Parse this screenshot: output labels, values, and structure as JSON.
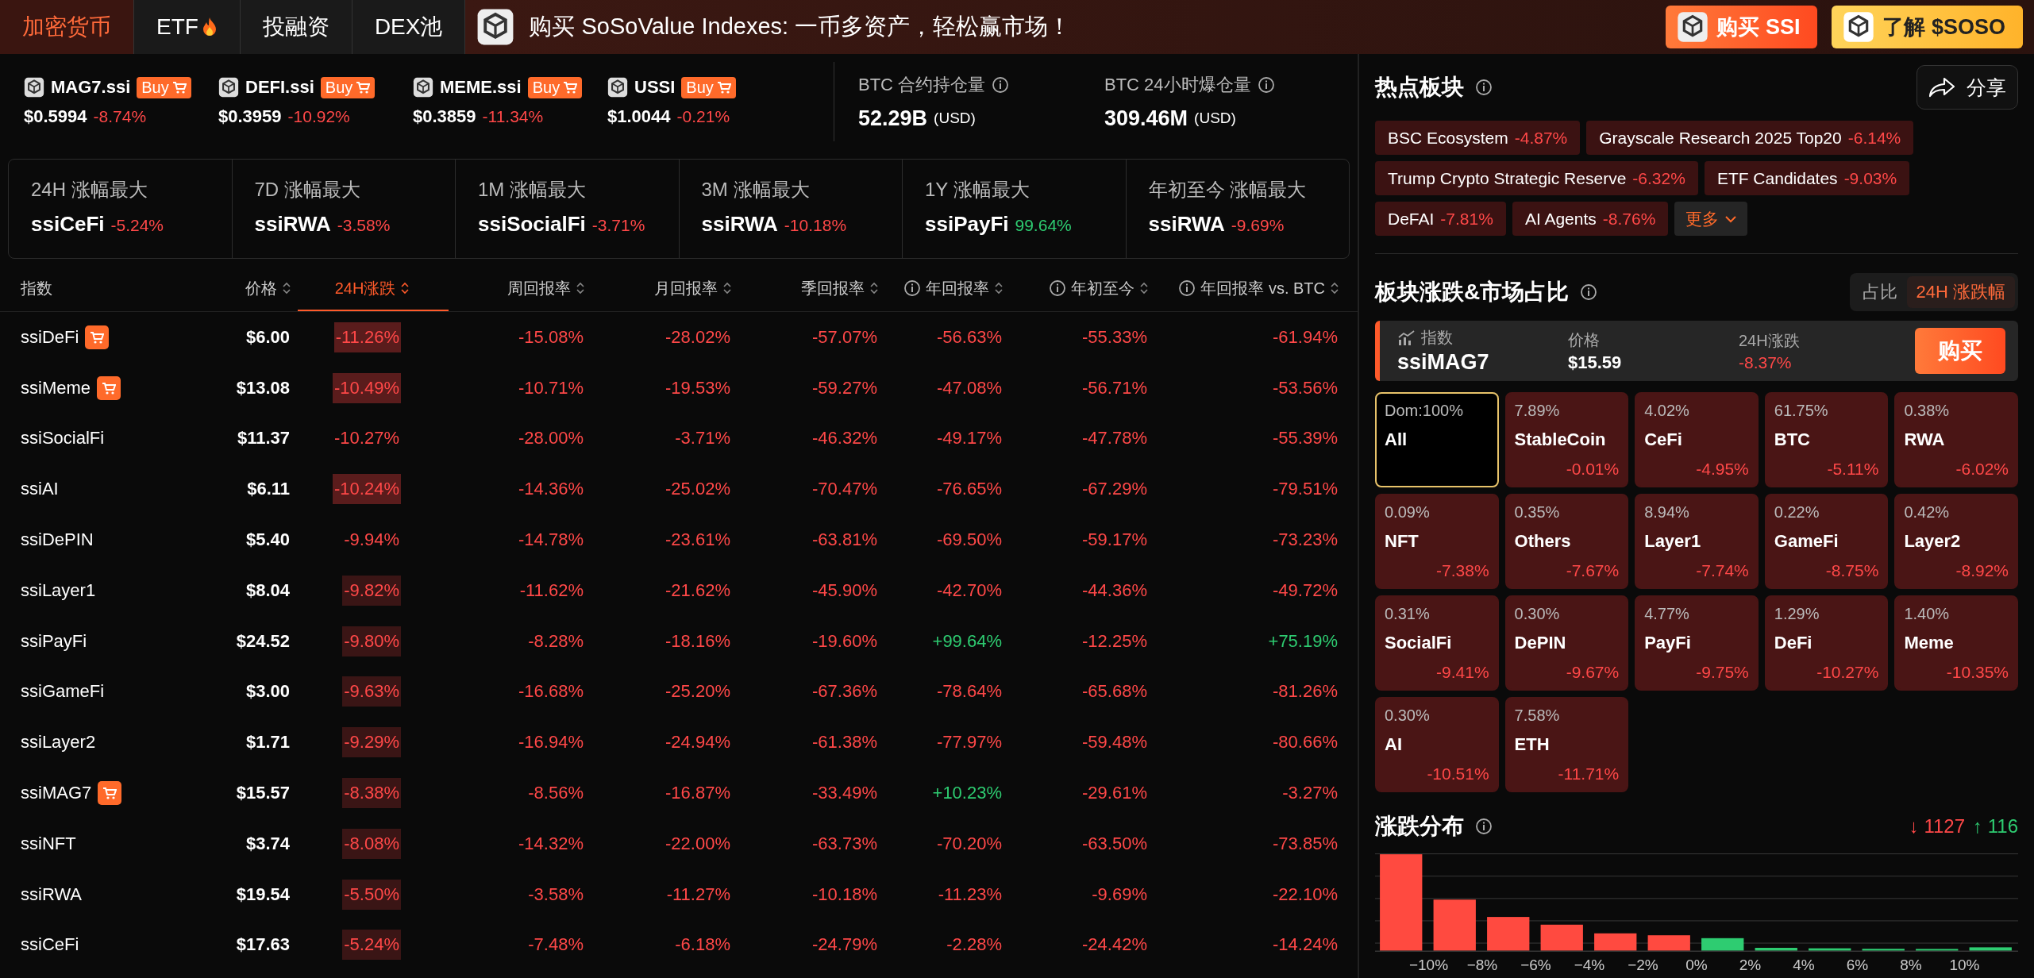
{
  "nav": {
    "tabs": [
      {
        "label": "加密货币",
        "selected": true,
        "hot": false
      },
      {
        "label": "ETF",
        "selected": false,
        "hot": true
      },
      {
        "label": "投融资",
        "selected": false,
        "hot": false
      },
      {
        "label": "DEX池",
        "selected": false,
        "hot": false
      }
    ]
  },
  "banner": {
    "text": "购买 SoSoValue Indexes: 一币多资产，轻松赢市场！",
    "buttons": [
      {
        "label": "购买 SSI",
        "kind": "primary"
      },
      {
        "label": "了解 $SOSO",
        "kind": "secondary"
      }
    ]
  },
  "tickers": [
    {
      "name": "MAG7.ssi",
      "buy": "Buy",
      "price": "$0.5994",
      "change": "-8.74%",
      "up": false
    },
    {
      "name": "DEFI.ssi",
      "buy": "Buy",
      "price": "$0.3959",
      "change": "-10.92%",
      "up": false
    },
    {
      "name": "MEME.ssi",
      "buy": "Buy",
      "price": "$0.3859",
      "change": "-11.34%",
      "up": false
    },
    {
      "name": "USSI",
      "buy": "Buy",
      "price": "$1.0044",
      "change": "-0.21%",
      "up": false
    }
  ],
  "metrics": [
    {
      "label": "BTC 合约持仓量",
      "value": "52.29B",
      "unit": "(USD)"
    },
    {
      "label": "BTC 24小时爆仓量",
      "value": "309.46M",
      "unit": "(USD)"
    }
  ],
  "leaders": [
    {
      "label": "24H 涨幅最大",
      "name": "ssiCeFi",
      "change": "-5.24%",
      "up": false
    },
    {
      "label": "7D 涨幅最大",
      "name": "ssiRWA",
      "change": "-3.58%",
      "up": false
    },
    {
      "label": "1M 涨幅最大",
      "name": "ssiSocialFi",
      "change": "-3.71%",
      "up": false
    },
    {
      "label": "3M 涨幅最大",
      "name": "ssiRWA",
      "change": "-10.18%",
      "up": false
    },
    {
      "label": "1Y 涨幅最大",
      "name": "ssiPayFi",
      "change": "99.64%",
      "up": true
    },
    {
      "label": "年初至今 涨幅最大",
      "name": "ssiRWA",
      "change": "-9.69%",
      "up": false
    }
  ],
  "table": {
    "columns": [
      {
        "label": "指数",
        "info": false,
        "sortable": false,
        "selected": false
      },
      {
        "label": "价格",
        "info": false,
        "sortable": true,
        "selected": false
      },
      {
        "label": "24H涨跌",
        "info": false,
        "sortable": true,
        "selected": true
      },
      {
        "label": "周回报率",
        "info": false,
        "sortable": true,
        "selected": false
      },
      {
        "label": "月回报率",
        "info": false,
        "sortable": true,
        "selected": false
      },
      {
        "label": "季回报率",
        "info": false,
        "sortable": true,
        "selected": false
      },
      {
        "label": "年回报率",
        "info": true,
        "sortable": true,
        "selected": false
      },
      {
        "label": "年初至今",
        "info": true,
        "sortable": true,
        "selected": false
      },
      {
        "label": "年回报率 vs. BTC",
        "info": true,
        "sortable": true,
        "selected": false
      }
    ],
    "rows": [
      {
        "cart": true,
        "highlighted": true,
        "strong": true,
        "cells": [
          {
            "text": "ssiDeFi"
          },
          {
            "text": "$6.00"
          },
          {
            "text": "-11.26%",
            "up": false
          },
          {
            "text": "-15.08%",
            "up": false
          },
          {
            "text": "-28.02%",
            "up": false
          },
          {
            "text": "-57.07%",
            "up": false
          },
          {
            "text": "-56.63%",
            "up": false
          },
          {
            "text": "-55.33%",
            "up": false
          },
          {
            "text": "-61.94%",
            "up": false
          }
        ]
      },
      {
        "cart": true,
        "highlighted": true,
        "strong": true,
        "cells": [
          {
            "text": "ssiMeme"
          },
          {
            "text": "$13.08"
          },
          {
            "text": "-10.49%",
            "up": false
          },
          {
            "text": "-10.71%",
            "up": false
          },
          {
            "text": "-19.53%",
            "up": false
          },
          {
            "text": "-59.27%",
            "up": false
          },
          {
            "text": "-47.08%",
            "up": false
          },
          {
            "text": "-56.71%",
            "up": false
          },
          {
            "text": "-53.56%",
            "up": false
          }
        ]
      },
      {
        "cart": false,
        "highlighted": false,
        "strong": false,
        "cells": [
          {
            "text": "ssiSocialFi"
          },
          {
            "text": "$11.37"
          },
          {
            "text": "-10.27%",
            "up": false
          },
          {
            "text": "-28.00%",
            "up": false
          },
          {
            "text": "-3.71%",
            "up": false
          },
          {
            "text": "-46.32%",
            "up": false
          },
          {
            "text": "-49.17%",
            "up": false
          },
          {
            "text": "-47.78%",
            "up": false
          },
          {
            "text": "-55.39%",
            "up": false
          }
        ]
      },
      {
        "cart": false,
        "highlighted": true,
        "strong": true,
        "cells": [
          {
            "text": "ssiAI"
          },
          {
            "text": "$6.11"
          },
          {
            "text": "-10.24%",
            "up": false
          },
          {
            "text": "-14.36%",
            "up": false
          },
          {
            "text": "-25.02%",
            "up": false
          },
          {
            "text": "-70.47%",
            "up": false
          },
          {
            "text": "-76.65%",
            "up": false
          },
          {
            "text": "-67.29%",
            "up": false
          },
          {
            "text": "-79.51%",
            "up": false
          }
        ]
      },
      {
        "cart": false,
        "highlighted": false,
        "strong": false,
        "cells": [
          {
            "text": "ssiDePIN"
          },
          {
            "text": "$5.40"
          },
          {
            "text": "-9.94%",
            "up": false
          },
          {
            "text": "-14.78%",
            "up": false
          },
          {
            "text": "-23.61%",
            "up": false
          },
          {
            "text": "-63.81%",
            "up": false
          },
          {
            "text": "-69.50%",
            "up": false
          },
          {
            "text": "-59.17%",
            "up": false
          },
          {
            "text": "-73.23%",
            "up": false
          }
        ]
      },
      {
        "cart": false,
        "highlighted": true,
        "strong": false,
        "cells": [
          {
            "text": "ssiLayer1"
          },
          {
            "text": "$8.04"
          },
          {
            "text": "-9.82%",
            "up": false
          },
          {
            "text": "-11.62%",
            "up": false
          },
          {
            "text": "-21.62%",
            "up": false
          },
          {
            "text": "-45.90%",
            "up": false
          },
          {
            "text": "-42.70%",
            "up": false
          },
          {
            "text": "-44.36%",
            "up": false
          },
          {
            "text": "-49.72%",
            "up": false
          }
        ]
      },
      {
        "cart": false,
        "highlighted": true,
        "strong": false,
        "cells": [
          {
            "text": "ssiPayFi"
          },
          {
            "text": "$24.52"
          },
          {
            "text": "-9.80%",
            "up": false
          },
          {
            "text": "-8.28%",
            "up": false
          },
          {
            "text": "-18.16%",
            "up": false
          },
          {
            "text": "-19.60%",
            "up": false
          },
          {
            "text": "+99.64%",
            "up": true
          },
          {
            "text": "-12.25%",
            "up": false
          },
          {
            "text": "+75.19%",
            "up": true
          }
        ]
      },
      {
        "cart": false,
        "highlighted": true,
        "strong": false,
        "cells": [
          {
            "text": "ssiGameFi"
          },
          {
            "text": "$3.00"
          },
          {
            "text": "-9.63%",
            "up": false
          },
          {
            "text": "-16.68%",
            "up": false
          },
          {
            "text": "-25.20%",
            "up": false
          },
          {
            "text": "-67.36%",
            "up": false
          },
          {
            "text": "-78.64%",
            "up": false
          },
          {
            "text": "-65.68%",
            "up": false
          },
          {
            "text": "-81.26%",
            "up": false
          }
        ]
      },
      {
        "cart": false,
        "highlighted": true,
        "strong": false,
        "cells": [
          {
            "text": "ssiLayer2"
          },
          {
            "text": "$1.71"
          },
          {
            "text": "-9.29%",
            "up": false
          },
          {
            "text": "-16.94%",
            "up": false
          },
          {
            "text": "-24.94%",
            "up": false
          },
          {
            "text": "-61.38%",
            "up": false
          },
          {
            "text": "-77.97%",
            "up": false
          },
          {
            "text": "-59.48%",
            "up": false
          },
          {
            "text": "-80.66%",
            "up": false
          }
        ]
      },
      {
        "cart": true,
        "highlighted": true,
        "strong": false,
        "cells": [
          {
            "text": "ssiMAG7"
          },
          {
            "text": "$15.57"
          },
          {
            "text": "-8.38%",
            "up": false
          },
          {
            "text": "-8.56%",
            "up": false
          },
          {
            "text": "-16.87%",
            "up": false
          },
          {
            "text": "-33.49%",
            "up": false
          },
          {
            "text": "+10.23%",
            "up": true
          },
          {
            "text": "-29.61%",
            "up": false
          },
          {
            "text": "-3.27%",
            "up": false
          }
        ]
      },
      {
        "cart": false,
        "highlighted": true,
        "strong": false,
        "cells": [
          {
            "text": "ssiNFT"
          },
          {
            "text": "$3.74"
          },
          {
            "text": "-8.08%",
            "up": false
          },
          {
            "text": "-14.32%",
            "up": false
          },
          {
            "text": "-22.00%",
            "up": false
          },
          {
            "text": "-63.73%",
            "up": false
          },
          {
            "text": "-70.20%",
            "up": false
          },
          {
            "text": "-63.50%",
            "up": false
          },
          {
            "text": "-73.85%",
            "up": false
          }
        ]
      },
      {
        "cart": false,
        "highlighted": true,
        "strong": false,
        "cells": [
          {
            "text": "ssiRWA"
          },
          {
            "text": "$19.54"
          },
          {
            "text": "-5.50%",
            "up": false
          },
          {
            "text": "-3.58%",
            "up": false
          },
          {
            "text": "-11.27%",
            "up": false
          },
          {
            "text": "-10.18%",
            "up": false
          },
          {
            "text": "-11.23%",
            "up": false
          },
          {
            "text": "-9.69%",
            "up": false
          },
          {
            "text": "-22.10%",
            "up": false
          }
        ]
      },
      {
        "cart": false,
        "highlighted": true,
        "strong": false,
        "cells": [
          {
            "text": "ssiCeFi"
          },
          {
            "text": "$17.63"
          },
          {
            "text": "-5.24%",
            "up": false
          },
          {
            "text": "-7.48%",
            "up": false
          },
          {
            "text": "-6.18%",
            "up": false
          },
          {
            "text": "-24.79%",
            "up": false
          },
          {
            "text": "-2.28%",
            "up": false
          },
          {
            "text": "-24.42%",
            "up": false
          },
          {
            "text": "-14.24%",
            "up": false
          }
        ]
      }
    ]
  },
  "hot_sectors": {
    "title": "热点板块",
    "share": "分享",
    "more": "更多",
    "tags": [
      {
        "name": "BSC Ecosystem",
        "change": "-4.87%",
        "up": false
      },
      {
        "name": "Grayscale Research 2025 Top20",
        "change": "-6.14%",
        "up": false
      },
      {
        "name": "Trump Crypto Strategic Reserve",
        "change": "-6.32%",
        "up": false
      },
      {
        "name": "ETF Candidates",
        "change": "-9.03%",
        "up": false
      },
      {
        "name": "DeFAI",
        "change": "-7.81%",
        "up": false
      },
      {
        "name": "AI Agents",
        "change": "-8.76%",
        "up": false
      }
    ]
  },
  "sector_map": {
    "title": "板块涨跌&市场占比",
    "toggle": [
      {
        "label": "占比",
        "selected": false
      },
      {
        "label": "24H 涨跌幅",
        "selected": true
      }
    ],
    "index": {
      "label": "指数",
      "name": "ssiMAG7",
      "price_label": "价格",
      "price": "$15.59",
      "change_label": "24H涨跌",
      "change": "-8.37%",
      "up": false,
      "button": "购买"
    },
    "tiles": [
      {
        "share": "Dom:100%",
        "name": "All",
        "selected": true
      },
      {
        "share": "7.89%",
        "name": "StableCoin",
        "change": "-0.01%",
        "up": false,
        "selected": false
      },
      {
        "share": "4.02%",
        "name": "CeFi",
        "change": "-4.95%",
        "up": false,
        "selected": false
      },
      {
        "share": "61.75%",
        "name": "BTC",
        "change": "-5.11%",
        "up": false,
        "selected": false
      },
      {
        "share": "0.38%",
        "name": "RWA",
        "change": "-6.02%",
        "up": false,
        "selected": false
      },
      {
        "share": "0.09%",
        "name": "NFT",
        "change": "-7.38%",
        "up": false,
        "selected": false
      },
      {
        "share": "0.35%",
        "name": "Others",
        "change": "-7.67%",
        "up": false,
        "selected": false
      },
      {
        "share": "8.94%",
        "name": "Layer1",
        "change": "-7.74%",
        "up": false,
        "selected": false
      },
      {
        "share": "0.22%",
        "name": "GameFi",
        "change": "-8.75%",
        "up": false,
        "selected": false
      },
      {
        "share": "0.42%",
        "name": "Layer2",
        "change": "-8.92%",
        "up": false,
        "selected": false
      },
      {
        "share": "0.31%",
        "name": "SocialFi",
        "change": "-9.41%",
        "up": false,
        "selected": false
      },
      {
        "share": "0.30%",
        "name": "DePIN",
        "change": "-9.67%",
        "up": false,
        "selected": false
      },
      {
        "share": "4.77%",
        "name": "PayFi",
        "change": "-9.75%",
        "up": false,
        "selected": false
      },
      {
        "share": "1.29%",
        "name": "DeFi",
        "change": "-10.27%",
        "up": false,
        "selected": false
      },
      {
        "share": "1.40%",
        "name": "Meme",
        "change": "-10.35%",
        "up": false,
        "selected": false
      },
      {
        "share": "0.30%",
        "name": "AI",
        "change": "-10.51%",
        "up": false,
        "selected": false
      },
      {
        "share": "7.58%",
        "name": "ETH",
        "change": "-11.71%",
        "up": false,
        "selected": false
      }
    ]
  },
  "distribution": {
    "title": "涨跌分布",
    "down": "↓ 1127",
    "up": "↑ 116",
    "x_labels": [
      "−10%",
      "−8%",
      "−6%",
      "−4%",
      "−2%",
      "0%",
      "2%",
      "4%",
      "6%",
      "8%",
      "10%"
    ]
  }
}
